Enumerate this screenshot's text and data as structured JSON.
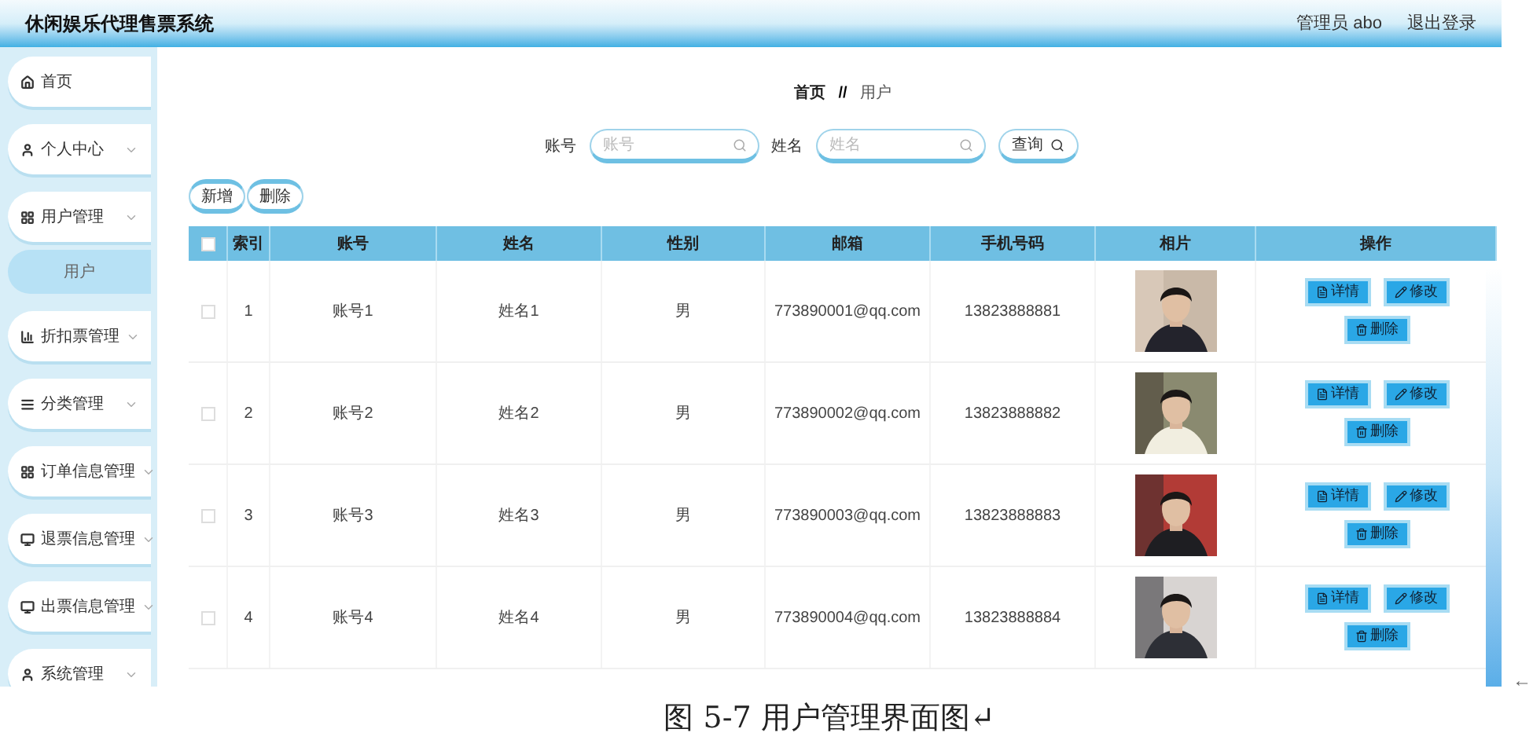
{
  "header": {
    "title": "休闲娱乐代理售票系统",
    "user": "管理员 abo",
    "logout": "退出登录"
  },
  "sidebar": {
    "items": [
      {
        "label": "首页",
        "expandable": false
      },
      {
        "label": "个人中心",
        "expandable": true
      },
      {
        "label": "用户管理",
        "expandable": true,
        "children": [
          {
            "label": "用户",
            "selected": true
          }
        ]
      },
      {
        "label": "折扣票管理",
        "expandable": true
      },
      {
        "label": "分类管理",
        "expandable": true
      },
      {
        "label": "订单信息管理",
        "expandable": true
      },
      {
        "label": "退票信息管理",
        "expandable": true
      },
      {
        "label": "出票信息管理",
        "expandable": true
      },
      {
        "label": "系统管理",
        "expandable": true
      }
    ]
  },
  "breadcrumb": {
    "items": [
      "首页",
      "用户"
    ],
    "separator": "//"
  },
  "search": {
    "fields": [
      {
        "label": "账号",
        "placeholder": "账号"
      },
      {
        "label": "姓名",
        "placeholder": "姓名"
      }
    ],
    "button": "查询"
  },
  "actions": [
    "新增",
    "删除"
  ],
  "table": {
    "select_all_checked": false,
    "columns": [
      "索引",
      "账号",
      "姓名",
      "性别",
      "邮箱",
      "手机号码",
      "相片",
      "操作"
    ],
    "rows": [
      {
        "checked": false,
        "cells": [
          "1",
          "账号1",
          "姓名1",
          "男",
          "773890001@qq.com",
          "13823888881"
        ],
        "photo": {
          "kind": "picture"
        },
        "buttons": [
          "详情",
          "修改",
          "删除"
        ]
      },
      {
        "checked": false,
        "cells": [
          "2",
          "账号2",
          "姓名2",
          "男",
          "773890002@qq.com",
          "13823888882"
        ],
        "photo": {
          "kind": "picture"
        },
        "buttons": [
          "详情",
          "修改",
          "删除"
        ]
      },
      {
        "checked": false,
        "cells": [
          "3",
          "账号3",
          "姓名3",
          "男",
          "773890003@qq.com",
          "13823888883"
        ],
        "photo": {
          "kind": "picture"
        },
        "buttons": [
          "详情",
          "修改",
          "删除"
        ]
      },
      {
        "checked": false,
        "cells": [
          "4",
          "账号4",
          "姓名4",
          "男",
          "773890004@qq.com",
          "13823888884"
        ],
        "photo": {
          "kind": "picture"
        },
        "buttons": [
          "详情",
          "修改",
          "删除"
        ]
      }
    ]
  },
  "caption": "图 5-7 用户管理界面图↵",
  "edge_mark": "←"
}
